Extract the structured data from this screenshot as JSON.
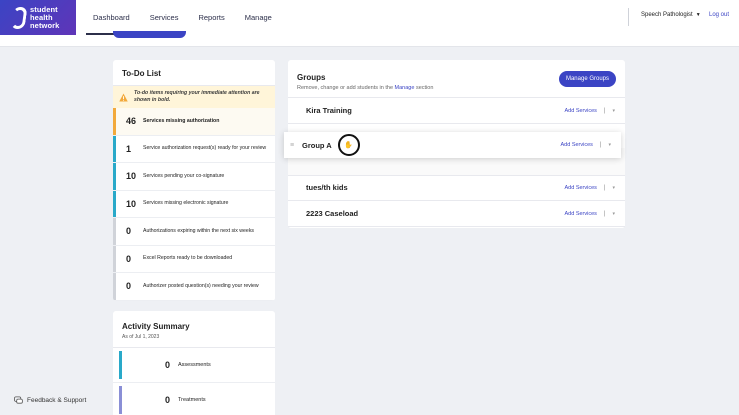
{
  "brand": {
    "line1": "student",
    "line2": "health",
    "line3": "network"
  },
  "nav": [
    {
      "label": "Dashboard"
    },
    {
      "label": "Services"
    },
    {
      "label": "Reports"
    },
    {
      "label": "Manage"
    }
  ],
  "header": {
    "role": "Speech Pathologist",
    "logout": "Log out"
  },
  "todo": {
    "title": "To-Do List",
    "note": "To-do items requiring your immediate attention are shown in bold.",
    "items": [
      {
        "count": "46",
        "label": "Services missing authorization",
        "color": "#f2a93b"
      },
      {
        "count": "1",
        "label": "Service authorization request(s) ready for your review",
        "color": "#29a9c9"
      },
      {
        "count": "10",
        "label": "Services pending your co-signature",
        "color": "#29a9c9"
      },
      {
        "count": "10",
        "label": "Services missing electronic signature",
        "color": "#29a9c9"
      },
      {
        "count": "0",
        "label": "Authorizations expiring within the next six weeks",
        "color": "#d0d3d9"
      },
      {
        "count": "0",
        "label": "Excel Reports ready to be downloaded",
        "color": "#d0d3d9"
      },
      {
        "count": "0",
        "label": "Authorizer posted question(s) needing your review",
        "color": "#d0d3d9"
      }
    ]
  },
  "activity": {
    "title": "Activity Summary",
    "subtitle": "As of Jul 1, 2023",
    "items": [
      {
        "count": "0",
        "label": "Assessments",
        "color": "#29a9c9"
      },
      {
        "count": "0",
        "label": "Treatments",
        "color": "#8a8fd6"
      }
    ]
  },
  "groups": {
    "title": "Groups",
    "subtitle_pre": "Remove, change or add students in the ",
    "subtitle_link": "Manage",
    "subtitle_post": " section",
    "manage_button": "Manage Groups",
    "add_services": "Add Services",
    "separator": "|",
    "rows": [
      {
        "name": "Kira Training"
      },
      {
        "name": "tues/th kids"
      },
      {
        "name": "2223 Caseload"
      }
    ],
    "dragging": {
      "name": "Group A"
    }
  },
  "feedback": {
    "label": "Feedback & Support"
  },
  "colors": {
    "accent": "#3b44c4",
    "warning": "#f2a93b",
    "info": "#29a9c9"
  }
}
